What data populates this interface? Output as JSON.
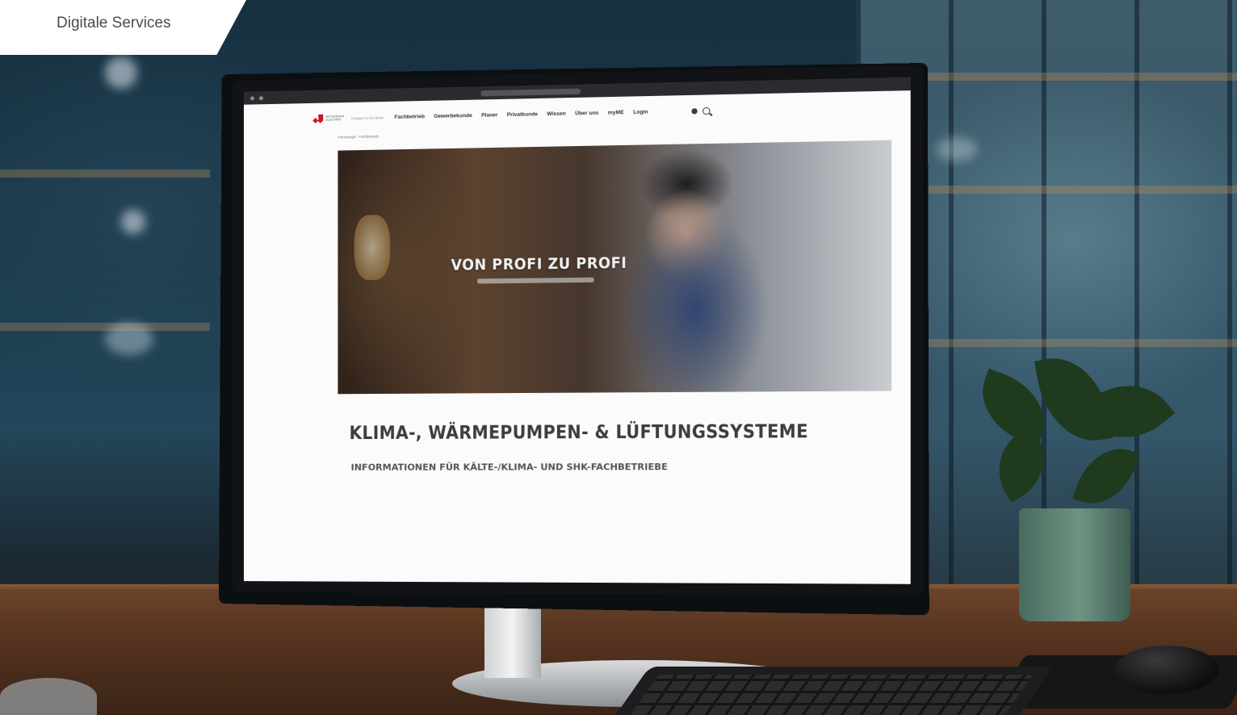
{
  "overlay_label": "Digitale Services",
  "website": {
    "logo_text": "MITSUBISHI ELECTRIC",
    "logo_subtext": "Changes for the Better",
    "nav": [
      "Fachbetrieb",
      "Gewerbekunde",
      "Planer",
      "Privatkunde",
      "Wissen",
      "Über uns",
      "myME",
      "Login"
    ],
    "breadcrumb": "Homepage › Fachbetrieb",
    "hero_title": "VON PROFI ZU PROFI",
    "heading": "KLIMA-, WÄRMEPUMPEN- & LÜFTUNGSSYSTEME",
    "subheading": "INFORMATIONEN FÜR KÄLTE-/KLIMA- UND SHK-FACHBETRIEBE"
  },
  "colors": {
    "brand_red": "#c9162a",
    "tab_background": "#ffffff",
    "label_text": "#4a4a4a"
  },
  "icons": [
    "globe-icon",
    "search-icon"
  ]
}
